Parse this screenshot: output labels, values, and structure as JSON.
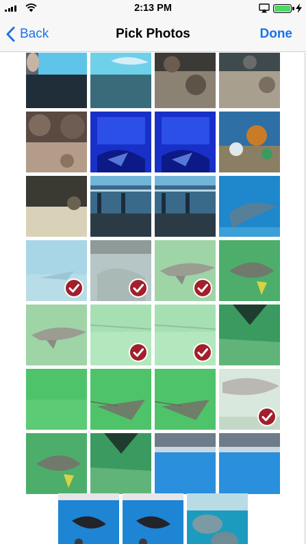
{
  "status_bar": {
    "time": "2:13 PM",
    "signal_bars": 4,
    "battery_level": 1.0,
    "icons": [
      "signal-icon",
      "wifi-icon",
      "airplay-icon",
      "battery-icon",
      "charging-bolt-icon"
    ]
  },
  "nav": {
    "back_label": "Back",
    "title": "Pick Photos",
    "done_label": "Done"
  },
  "colors": {
    "accent": "#1a73e8",
    "check_red": "#a21f2c"
  },
  "photos": [
    {
      "scene": "window",
      "selected": false
    },
    {
      "scene": "tank-light",
      "selected": false
    },
    {
      "scene": "rocks-dark",
      "selected": false
    },
    {
      "scene": "fish-dark",
      "selected": false
    },
    {
      "scene": "reef",
      "selected": false
    },
    {
      "scene": "blue-dark",
      "selected": false
    },
    {
      "scene": "blue-dark",
      "selected": false
    },
    {
      "scene": "coral",
      "selected": false
    },
    {
      "scene": "sand",
      "selected": false
    },
    {
      "scene": "glass",
      "selected": false
    },
    {
      "scene": "glass",
      "selected": false
    },
    {
      "scene": "dolphin",
      "selected": false
    },
    {
      "scene": "haze-blue",
      "selected": true
    },
    {
      "scene": "haze-gray",
      "selected": true
    },
    {
      "scene": "shark-green",
      "selected": true
    },
    {
      "scene": "fish-green",
      "selected": false
    },
    {
      "scene": "shark-green",
      "selected": false
    },
    {
      "scene": "green-light",
      "selected": true
    },
    {
      "scene": "green-light",
      "selected": true
    },
    {
      "scene": "tail",
      "selected": false
    },
    {
      "scene": "green-plain",
      "selected": false
    },
    {
      "scene": "ray",
      "selected": false
    },
    {
      "scene": "ray",
      "selected": false
    },
    {
      "scene": "dolphin-gray",
      "selected": true
    },
    {
      "scene": "fish-green",
      "selected": false
    },
    {
      "scene": "tail",
      "selected": false
    },
    {
      "scene": "pool",
      "selected": false
    },
    {
      "scene": "pool",
      "selected": false
    },
    {
      "scene": "pool-animal",
      "selected": false
    },
    {
      "scene": "pool-animal",
      "selected": false
    },
    {
      "scene": "manatee",
      "selected": false
    }
  ]
}
